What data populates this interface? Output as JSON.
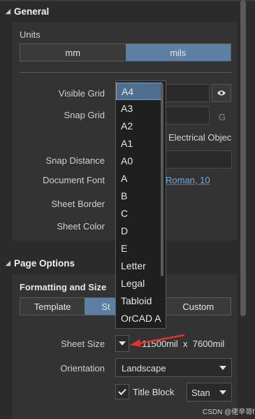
{
  "general": {
    "title": "General",
    "units_label": "Units",
    "units": {
      "mm": "mm",
      "mils": "mils",
      "selected": "mils"
    },
    "visible_grid_label": "Visible Grid",
    "snap_grid_label": "Snap Grid",
    "snap_grid_shortcut": "G",
    "electrical_text": "Electrical Objec",
    "snap_distance_label": "Snap Distance",
    "document_font_label": "Document Font",
    "document_font_value": "Roman, 10",
    "sheet_border_label": "Sheet Border",
    "sheet_color_label": "Sheet Color"
  },
  "dropdown": {
    "items": [
      "A4",
      "A3",
      "A2",
      "A1",
      "A0",
      "A",
      "B",
      "C",
      "D",
      "E",
      "Letter",
      "Legal",
      "Tabloid",
      "OrCAD A"
    ],
    "selected": "A4"
  },
  "page_options": {
    "title": "Page Options",
    "formatting_label": "Formatting and Size",
    "tabs": [
      "Template",
      "St",
      "Custom"
    ],
    "selected_tab": "St",
    "sheet_size_label": "Sheet Size",
    "sheet_size_value": "11500mil  x  7600mil",
    "orientation_label": "Orientation",
    "orientation_value": "Landscape",
    "title_block_label": "Title Block",
    "title_block_checked": true,
    "title_block_value": "Stan"
  },
  "watermark": "CSDN @佬辛哥f",
  "colors": {
    "background": "#2b2b2b",
    "panel": "#333333",
    "accent": "#5c7fa3",
    "arrow": "#e8312a",
    "link": "#6aa9e9"
  }
}
